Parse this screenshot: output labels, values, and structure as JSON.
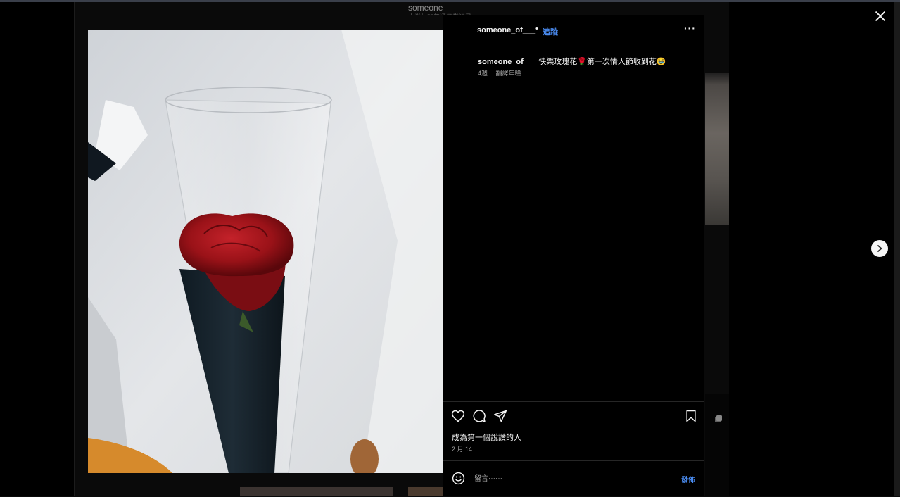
{
  "background": {
    "profile_name": "someone",
    "profile_subtext": "大学生的普通日常记录"
  },
  "post": {
    "username": "someone_of___",
    "follow_label": "追蹤",
    "more_label": "···",
    "caption_username": "someone_of___",
    "caption_text": "快樂玫瑰花🌹第一次情人節收到花🥹",
    "caption_age": "4週",
    "translate_label": "翻譯年糕",
    "likes_text": "成為第一個說讚的人",
    "date": "2 月 14",
    "comment_placeholder": "留言⋯⋯",
    "post_label": "發佈"
  },
  "icons": {
    "like": "heart-icon",
    "comment": "comment-icon",
    "share": "paper-plane-icon",
    "save": "bookmark-icon",
    "emoji": "smiley-icon",
    "close": "close-icon",
    "next": "chevron-right-icon"
  },
  "colors": {
    "accent": "#4a8bf0",
    "background": "#000000",
    "text": "#f5f5f5",
    "muted": "#a8a8a8"
  }
}
